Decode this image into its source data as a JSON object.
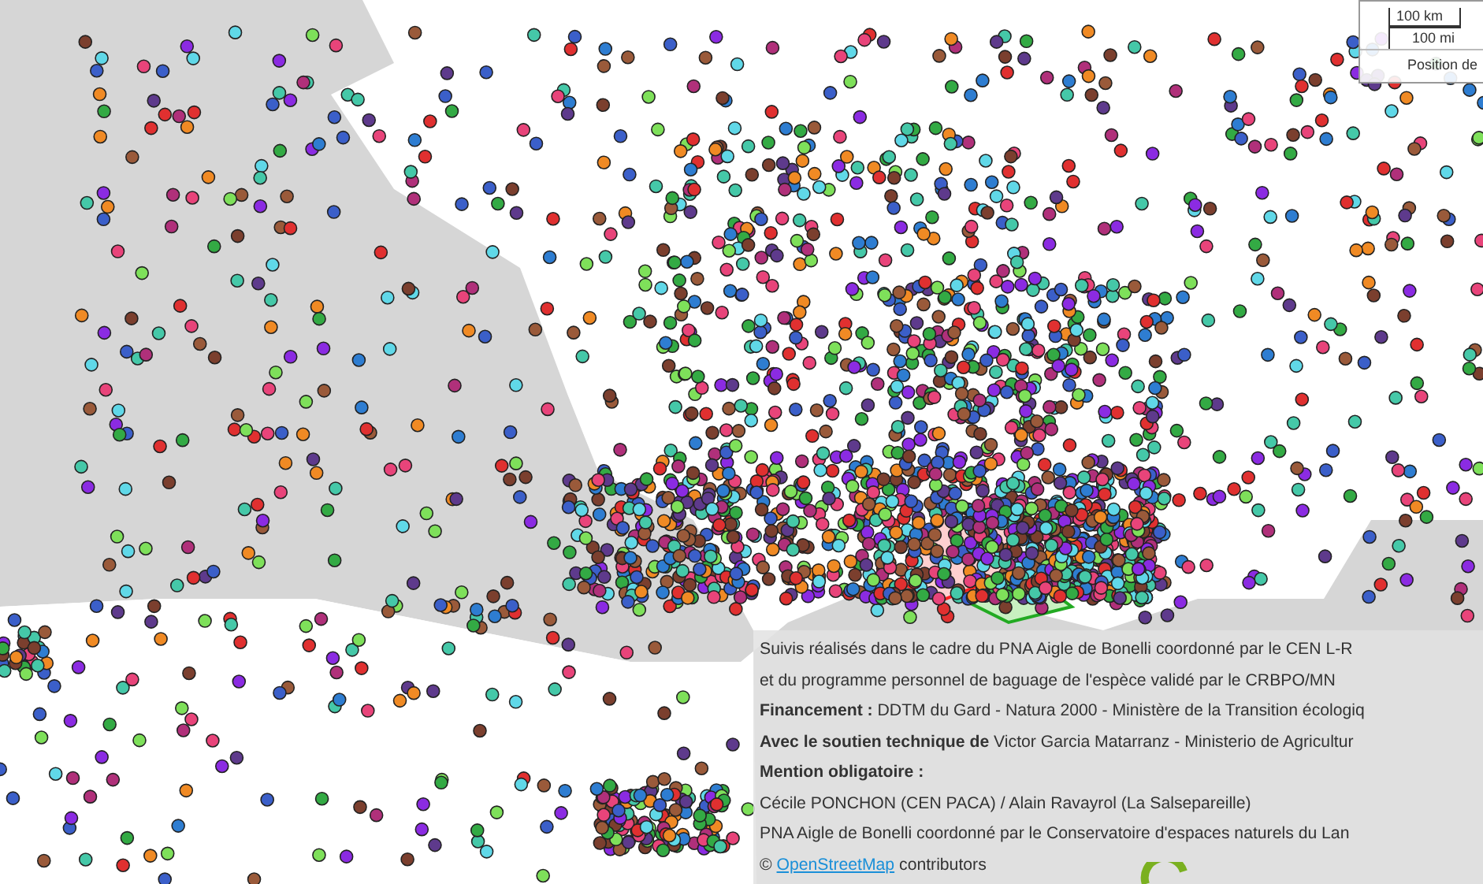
{
  "scale_control": {
    "metric": "100 km",
    "imperial": "100 mi"
  },
  "position_label": "Position de",
  "attribution": {
    "lines": [
      "Suivis réalisés dans le cadre du PNA Aigle de Bonelli coordonné par le CEN L-R",
      "et du programme personnel de baguage de l'espèce validé par le CRBPO/MN",
      "**Financement :** DDTM du Gard - Natura 2000 - Ministère de la Transition écologiq",
      "**Avec le soutien technique de** Victor Garcia Matarranz - Ministerio de Agricultur",
      "**Mention obligatoire :**",
      "Cécile PONCHON (CEN PACA) / Alain Ravayrol (La Salsepareille)",
      "PNA Aigle de Bonelli coordonné par le Conservatoire d'espaces naturels du Lan"
    ],
    "copyright": "©",
    "osm_link": "OpenStreetMap",
    "osm_suffix": "contributors"
  }
}
